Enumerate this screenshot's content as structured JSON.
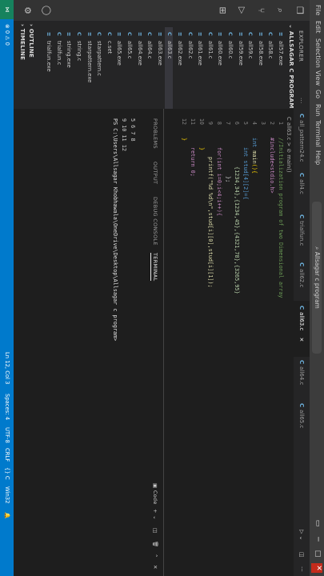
{
  "menu": [
    "File",
    "Edit",
    "Selection",
    "View",
    "Go",
    "Run",
    "Terminal",
    "Help"
  ],
  "search_placeholder": "Allsagar c program",
  "sidebar": {
    "explorer_label": "EXPLORER",
    "folder_label": "ALLSAGAR C PROGRAM",
    "files": [
      {
        "type": "exe",
        "name": "all57.exe"
      },
      {
        "type": "c",
        "name": "all58.c"
      },
      {
        "type": "exe",
        "name": "all58.exe"
      },
      {
        "type": "c",
        "name": "all59.c"
      },
      {
        "type": "exe",
        "name": "all59.exe"
      },
      {
        "type": "c",
        "name": "all60.c"
      },
      {
        "type": "exe",
        "name": "all60.exe"
      },
      {
        "type": "c",
        "name": "all61.c"
      },
      {
        "type": "exe",
        "name": "all61.exe"
      },
      {
        "type": "c",
        "name": "all62.c"
      },
      {
        "type": "exe",
        "name": "all62.exe"
      },
      {
        "type": "c",
        "name": "all63.c"
      },
      {
        "type": "exe",
        "name": "all63.exe"
      },
      {
        "type": "c",
        "name": "all64.c"
      },
      {
        "type": "exe",
        "name": "all64.exe"
      },
      {
        "type": "c",
        "name": "all65.c"
      },
      {
        "type": "exe",
        "name": "all65.exe"
      },
      {
        "type": "c",
        "name": "c.set"
      },
      {
        "type": "c",
        "name": "starpattern.c"
      },
      {
        "type": "exe",
        "name": "starpattern.exe"
      },
      {
        "type": "c",
        "name": "string.c"
      },
      {
        "type": "exe",
        "name": "string.exe"
      },
      {
        "type": "c",
        "name": "trialfun.c"
      },
      {
        "type": "exe",
        "name": "trialfun.exe"
      }
    ],
    "outline_label": "OUTLINE",
    "timeline_label": "TIMELINE"
  },
  "tabs": [
    {
      "label": "all_pattern24.c"
    },
    {
      "label": "all4.c"
    },
    {
      "label": "trialfun.c"
    },
    {
      "label": "all62.c"
    },
    {
      "label": "all63.c",
      "close": "×"
    },
    {
      "label": "all64.c"
    },
    {
      "label": "all65.c"
    }
  ],
  "breadcrumb": "C all63.c > ⊘ main()",
  "code_lines": [
    "1",
    "2",
    "3",
    "4",
    "5",
    "6",
    "7",
    "8",
    "9",
    "10",
    "11",
    "12"
  ],
  "code": {
    "l1": "//Initialization program of two Dimensional array",
    "l2": "#include<stdio.h>",
    "l4a": "int ",
    "l4b": "main",
    "l4c": "(){",
    "l5a": "int stud[4][2]={",
    "l6": "{1234,34},{1234,45},{4321,78},{3265,95}",
    "l7": "};",
    "l8": "for(int i=0;i<4;i++){",
    "l9": "printf(\"%d %d\\n\",stud[i][0],stud[i][1]);",
    "l10": "}",
    "l11": "return 0;",
    "l12": "}"
  },
  "panel": {
    "tabs": [
      "PROBLEMS",
      "OUTPUT",
      "DEBUG CONSOLE",
      "TERMINAL"
    ],
    "terminal_lines": [
      "5 6 7 8",
      "9 10 11 12",
      "PS C:\\Users\\Allsagar Khobhawala\\OneDrive\\Desktop\\Allsagar c program>"
    ],
    "shell_label": "Code"
  },
  "status": {
    "errors": "⊗ 0 ⚠ 0",
    "position": "Ln 12, Col 3",
    "spaces": "Spaces: 4",
    "encoding": "UTF-8",
    "eol": "CRLF",
    "language": "C",
    "platform": "Win32"
  }
}
